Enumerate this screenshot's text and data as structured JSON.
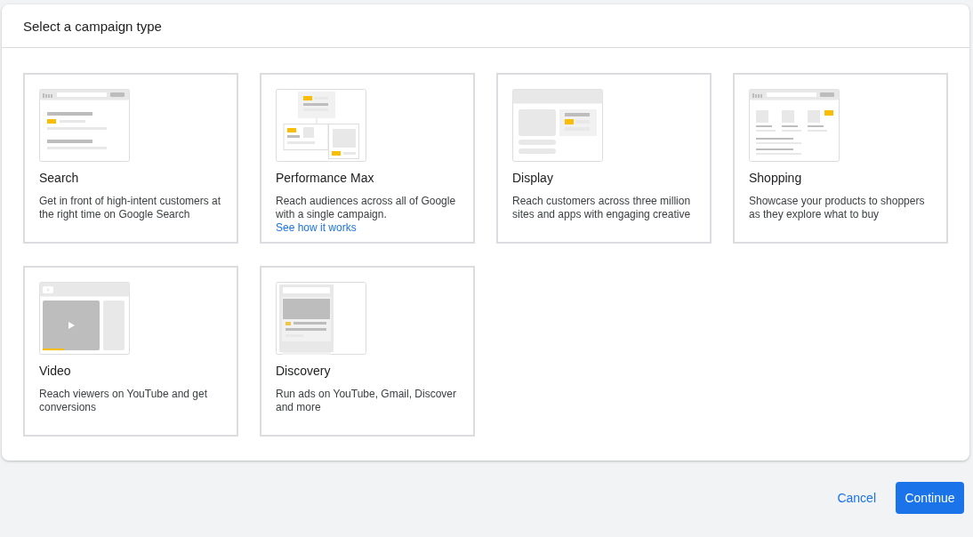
{
  "dialog": {
    "title": "Select a campaign type"
  },
  "campaign_types": [
    {
      "kind": "search",
      "title": "Search",
      "description": "Get in front of high-intent customers at the right time on Google Search"
    },
    {
      "kind": "performance_max",
      "title": "Performance Max",
      "description": "Reach audiences across all of Google with a single campaign.",
      "link": "See how it works"
    },
    {
      "kind": "display",
      "title": "Display",
      "description": "Reach customers across three million sites and apps with engaging creative"
    },
    {
      "kind": "shopping",
      "title": "Shopping",
      "description": "Showcase your products to shoppers as they explore what to buy"
    },
    {
      "kind": "video",
      "title": "Video",
      "description": "Reach viewers on YouTube and get conversions"
    },
    {
      "kind": "discovery",
      "title": "Discovery",
      "description": "Run ads on YouTube, Gmail, Discover and more"
    }
  ],
  "buttons": {
    "cancel": "Cancel",
    "continue": "Continue"
  }
}
